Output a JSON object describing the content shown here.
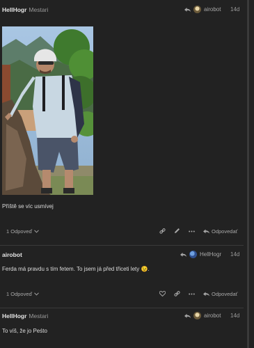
{
  "posts": [
    {
      "username": "HellHogr",
      "user_title": "Mestari",
      "reply_to_user": "airobot",
      "date": "14d",
      "text": "Příště se víc usmívej",
      "replies_button": "1 Odpoveď",
      "reply_button": "Odpovedať"
    },
    {
      "username": "airobot",
      "reply_to_user": "HellHogr",
      "date": "14d",
      "text": "Ferda má pravdu s tím fetem. To jsem já před třiceti lety 😉.",
      "replies_button": "1 Odpoveď",
      "reply_button": "Odpovedať"
    },
    {
      "username": "HellHogr",
      "user_title": "Mestari",
      "reply_to_user": "airobot",
      "date": "14d",
      "text": "To víš, že jo Peśto"
    }
  ],
  "colors": {
    "background": "#222222",
    "text": "#dddddd",
    "muted": "#9a9a9a",
    "divider": "#3a3a3a"
  }
}
